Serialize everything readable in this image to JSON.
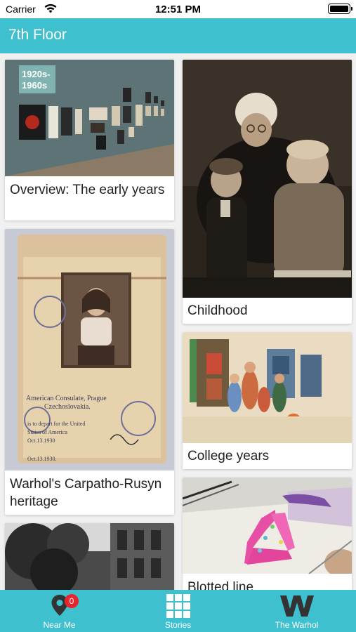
{
  "status_bar": {
    "carrier": "Carrier",
    "time": "12:51 PM"
  },
  "nav": {
    "title": "7th Floor"
  },
  "cards": [
    {
      "caption": "Overview: The early years",
      "image_text": "1920s-1960s"
    },
    {
      "caption": "Childhood"
    },
    {
      "caption": "Warhol's Carpatho-Rusyn heritage"
    },
    {
      "caption": "College years"
    },
    {
      "caption": "Blotted line"
    }
  ],
  "tab_bar": {
    "near_me_label": "Near Me",
    "near_me_badge": "0",
    "stories_label": "Stories",
    "warhol_label": "The Warhol"
  },
  "colors": {
    "accent": "#3fc0cf",
    "badge": "#e8242d"
  }
}
